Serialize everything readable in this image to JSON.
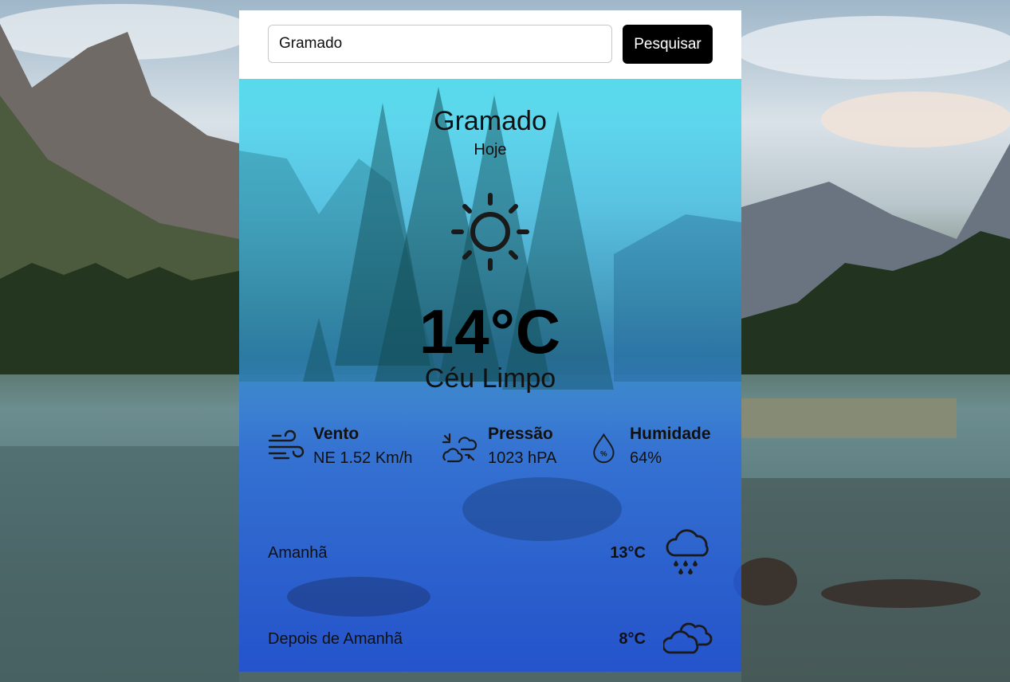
{
  "search": {
    "value": "Gramado",
    "button_label": "Pesquisar"
  },
  "current": {
    "city": "Gramado",
    "day": "Hoje",
    "icon": "sun-icon",
    "temperature": "14°C",
    "condition": "Céu Limpo"
  },
  "stats": [
    {
      "icon": "wind-icon",
      "label": "Vento",
      "value": "NE 1.52 Km/h"
    },
    {
      "icon": "pressure-icon",
      "label": "Pressão",
      "value": "1023 hPA"
    },
    {
      "icon": "humidity-icon",
      "label": "Humidade",
      "value": "64%"
    }
  ],
  "forecast": [
    {
      "day": "Amanhã",
      "temp": "13°C",
      "icon": "rain-cloud-icon"
    },
    {
      "day": "Depois de Amanhã",
      "temp": "8°C",
      "icon": "clouds-icon"
    }
  ],
  "colors": {
    "panel_top": "#40dcf0",
    "panel_bottom": "#1e50dc",
    "button": "#000000"
  }
}
